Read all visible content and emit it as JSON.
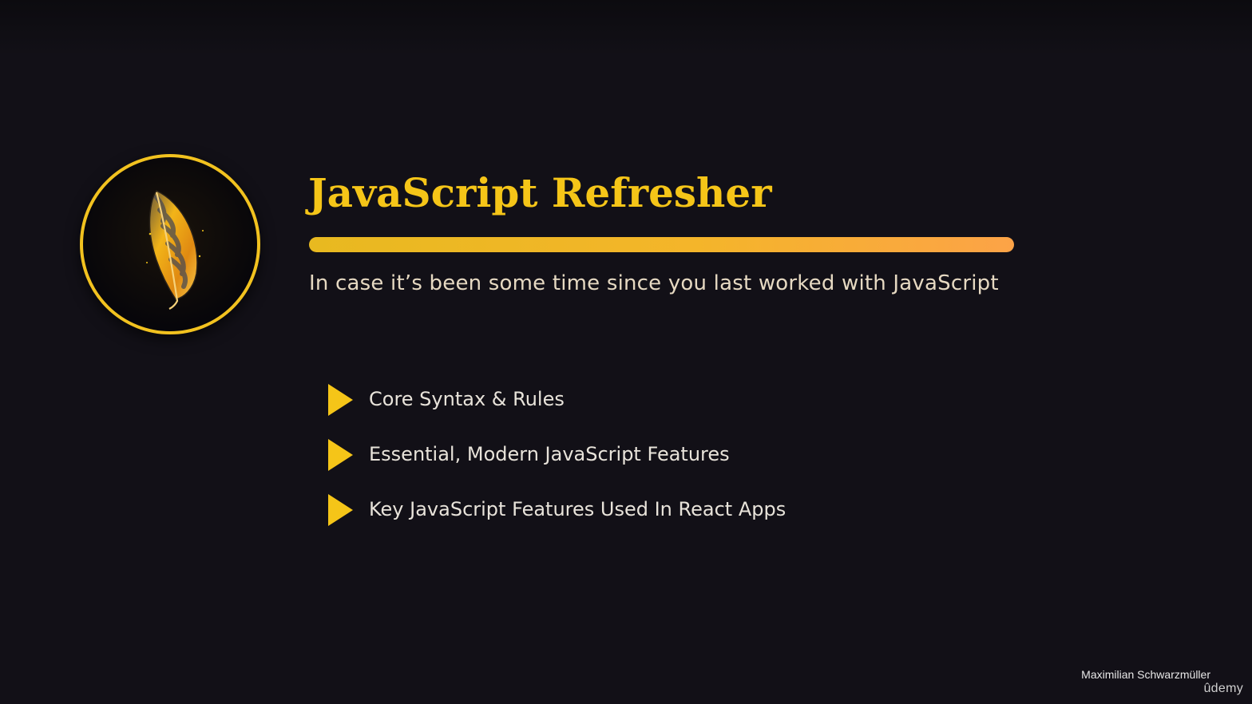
{
  "slide": {
    "title": "JavaScript Refresher",
    "subtitle": "In case it’s been some time since you last worked with JavaScript",
    "badge_icon": "feather-icon",
    "bullet_icon": "play-triangle-icon",
    "bullets": [
      {
        "label": "Core Syntax & Rules"
      },
      {
        "label": "Essential, Modern JavaScript Features"
      },
      {
        "label": "Key JavaScript Features Used In React Apps"
      }
    ]
  },
  "footer": {
    "author": "Maximilian Schwarzmüller",
    "brand": "ûdemy"
  },
  "colors": {
    "background": "#121017",
    "accent": "#f5c518",
    "accent_gradient_end": "#fca347",
    "subtitle": "#e6d9c2",
    "bullet_text": "#e8e3da"
  }
}
